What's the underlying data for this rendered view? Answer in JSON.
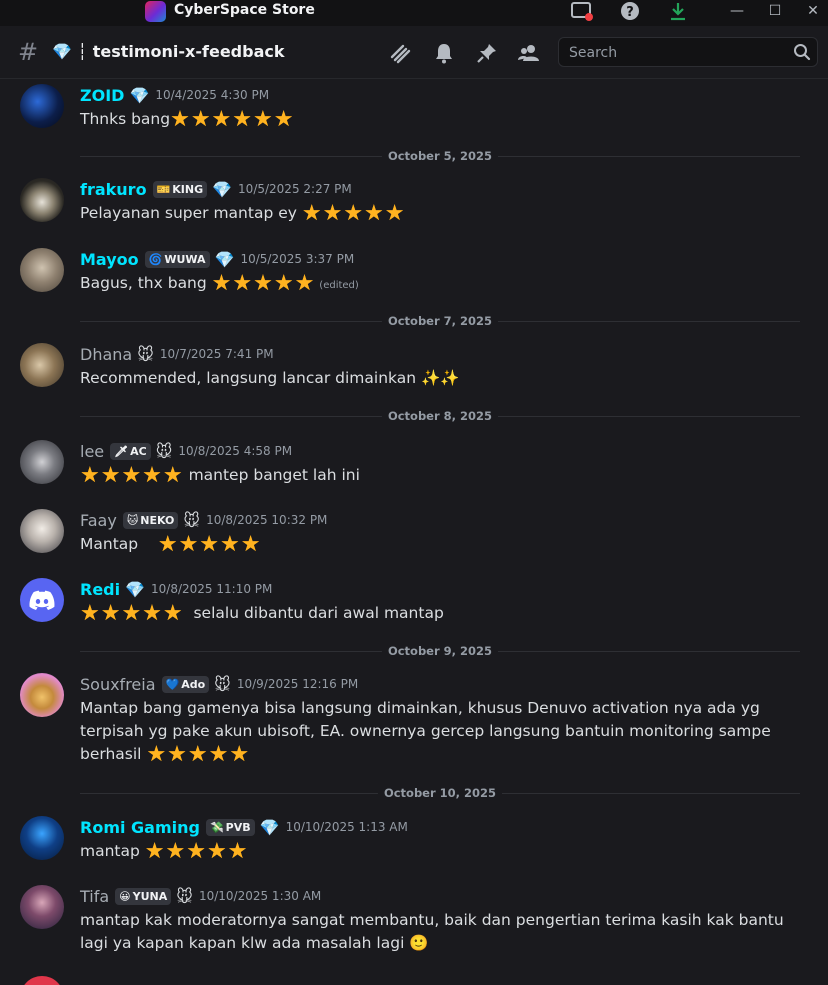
{
  "app": {
    "title": "CyberSpace Store"
  },
  "channel": {
    "prefix": "💎",
    "name": "┆ testimoni-x-feedback"
  },
  "search": {
    "placeholder": "Search"
  },
  "colors": {
    "accent_name": "#00e5ff",
    "neutral_name": "#a6acb3",
    "star": "#ffb320"
  },
  "messages": [
    {
      "user": "ZOID",
      "color": "#00e5ff",
      "badge": "💎",
      "tag": null,
      "time": "10/4/2025 4:30 PM",
      "text": "Thnks bang",
      "stars": "★★★★★★",
      "stars_after": true,
      "edited": null
    },
    {
      "user": "frakuro",
      "color": "#00e5ff",
      "badge": "💎",
      "tag": {
        "glyph": "🎫",
        "label": "KING"
      },
      "time": "10/5/2025 2:27 PM",
      "text": "Pelayanan super mantap ey",
      "stars": "★★★★★",
      "stars_after": true,
      "edited": null
    },
    {
      "user": "Mayoo",
      "color": "#00e5ff",
      "badge": "💎",
      "tag": {
        "glyph": "🌀",
        "label": "WUWA"
      },
      "time": "10/5/2025 3:37 PM",
      "text": "Bagus, thx bang",
      "stars": "★★★★★",
      "stars_after": true,
      "edited": "(edited)"
    },
    {
      "user": "Dhana",
      "color": "#a6acb3",
      "badge": "🐭",
      "tag": null,
      "time": "10/7/2025 7:41 PM",
      "text": "Recommended, langsung lancar dimainkan ✨✨",
      "stars": "",
      "stars_after": true,
      "edited": null
    },
    {
      "user": "lee",
      "color": "#a6acb3",
      "badge": "🐭",
      "tag": {
        "glyph": "🗡",
        "label": "AC"
      },
      "time": "10/8/2025 4:58 PM",
      "text": "mantep banget lah ini",
      "stars": "★★★★★",
      "stars_after": false,
      "edited": null
    },
    {
      "user": "Faay",
      "color": "#a6acb3",
      "badge": "🐭",
      "tag": {
        "glyph": "🐱",
        "label": "NEKO"
      },
      "time": "10/8/2025 10:32 PM",
      "text": "Mantap",
      "stars": "★★★★★",
      "stars_after": true,
      "edited": null
    },
    {
      "user": "Redi",
      "color": "#00e5ff",
      "badge": "💎",
      "tag": null,
      "time": "10/8/2025 11:10 PM",
      "text": "selalu dibantu dari awal mantap",
      "stars": "★★★★★",
      "stars_after": false,
      "edited": null
    },
    {
      "user": "Souxfreia",
      "color": "#a6acb3",
      "badge": "🐭",
      "tag": {
        "glyph": "💙",
        "label": "Ado"
      },
      "time": "10/9/2025 12:16 PM",
      "text": "Mantap bang gamenya bisa langsung dimainkan, khusus Denuvo activation nya ada yg terpisah yg pake akun ubisoft, EA. ownernya gercep langsung bantuin monitoring sampe berhasil",
      "stars": "★★★★★",
      "stars_after": true,
      "edited": null
    },
    {
      "user": "Romi Gaming",
      "color": "#00e5ff",
      "badge": "💎",
      "tag": {
        "glyph": "💸",
        "label": "PVB"
      },
      "time": "10/10/2025 1:13 AM",
      "text": "mantap",
      "stars": "★★★★★",
      "stars_after": true,
      "edited": null
    },
    {
      "user": "Tifa",
      "color": "#a6acb3",
      "badge": "🐭",
      "tag": {
        "glyph": "😀",
        "label": "YUNA"
      },
      "time": "10/10/2025 1:30 AM",
      "text": "mantap kak moderatornya sangat membantu, baik dan pengertian terima kasih kak bantu lagi ya kapan kapan klw ada masalah lagi 🙂",
      "stars": "",
      "stars_after": true,
      "edited": null
    }
  ],
  "dividers": [
    "October 5, 2025",
    "October 7, 2025",
    "October 8, 2025",
    "October 9, 2025",
    "October 10, 2025"
  ]
}
